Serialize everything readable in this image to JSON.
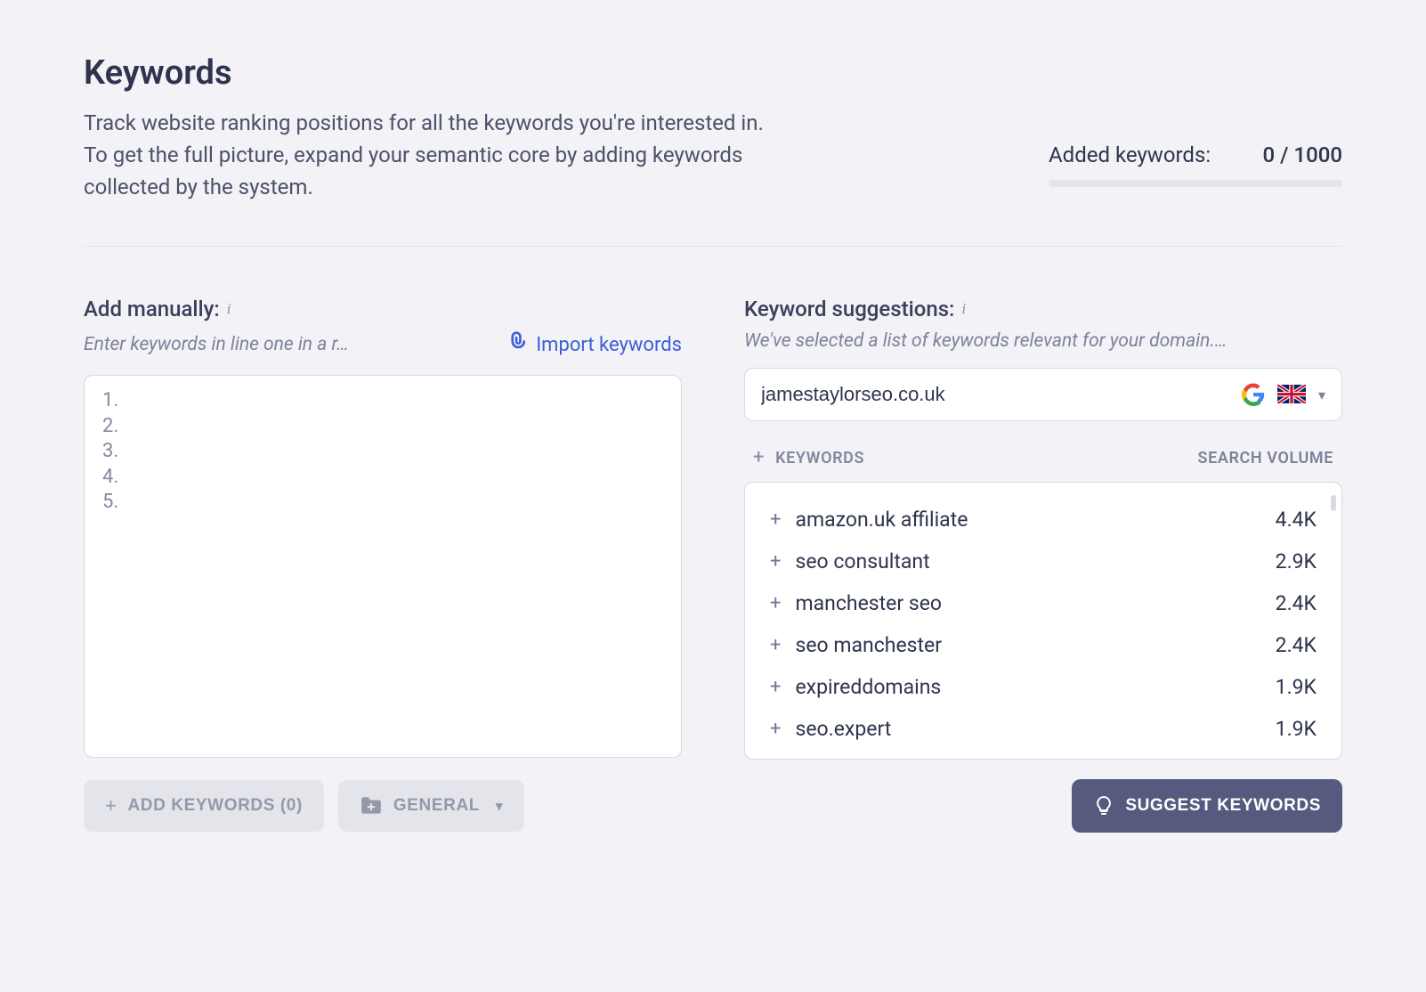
{
  "header": {
    "title": "Keywords",
    "subtitle": "Track website ranking positions for all the keywords you're interested in. To get the full picture, expand your semantic core by adding keywords collected by the system."
  },
  "added": {
    "label": "Added keywords:",
    "count": "0 / 1000"
  },
  "manual": {
    "title": "Add manually:",
    "helper": "Enter keywords in line one in a r…",
    "import_label": "Import keywords"
  },
  "suggestions": {
    "title": "Keyword suggestions:",
    "helper": "We've selected a list of keywords relevant for your domain.…",
    "domain": "jamestaylorseo.co.uk",
    "col_keywords": "KEYWORDS",
    "col_volume": "SEARCH VOLUME",
    "items": [
      {
        "keyword": "amazon.uk affiliate",
        "volume": "4.4K"
      },
      {
        "keyword": "seo consultant",
        "volume": "2.9K"
      },
      {
        "keyword": "manchester seo",
        "volume": "2.4K"
      },
      {
        "keyword": "seo manchester",
        "volume": "2.4K"
      },
      {
        "keyword": "expireddomains",
        "volume": "1.9K"
      },
      {
        "keyword": "seo.expert",
        "volume": "1.9K"
      }
    ]
  },
  "footer": {
    "add_keywords": "ADD KEYWORDS (0)",
    "general": "GENERAL",
    "suggest": "SUGGEST KEYWORDS"
  }
}
